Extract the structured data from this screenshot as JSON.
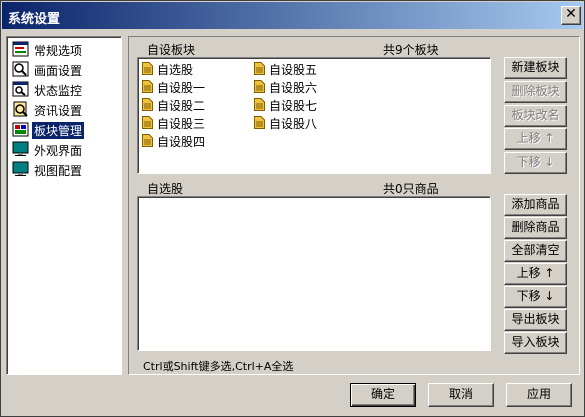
{
  "window": {
    "title": "系统设置",
    "close": "✕"
  },
  "nav": {
    "items": [
      {
        "label": "常规选项",
        "icon": "general-options-icon"
      },
      {
        "label": "画面设置",
        "icon": "display-settings-icon"
      },
      {
        "label": "状态监控",
        "icon": "status-monitor-icon"
      },
      {
        "label": "资讯设置",
        "icon": "news-settings-icon"
      },
      {
        "label": "板块管理",
        "icon": "board-management-icon",
        "selected": true
      },
      {
        "label": "外观界面",
        "icon": "appearance-icon"
      },
      {
        "label": "视图配置",
        "icon": "view-config-icon"
      }
    ]
  },
  "boards": {
    "header": "自设板块",
    "count": "共9个板块",
    "items": [
      "自选股",
      "自设股一",
      "自设股二",
      "自设股三",
      "自设股四",
      "自设股五",
      "自设股六",
      "自设股七",
      "自设股八"
    ],
    "buttons": {
      "new": "新建板块",
      "delete": "删除板块",
      "rename": "板块改名",
      "up": "上移 ↑",
      "down": "下移 ↓"
    }
  },
  "products": {
    "header": "自选股",
    "count": "共0只商品",
    "items": [],
    "buttons": {
      "add": "添加商品",
      "delete": "删除商品",
      "clear": "全部清空",
      "up": "上移 ↑",
      "down": "下移 ↓",
      "export": "导出板块",
      "import": "导入板块"
    }
  },
  "hint": "Ctrl或Shift键多选,Ctrl+A全选",
  "footer": {
    "ok": "确定",
    "cancel": "取消",
    "apply": "应用"
  }
}
